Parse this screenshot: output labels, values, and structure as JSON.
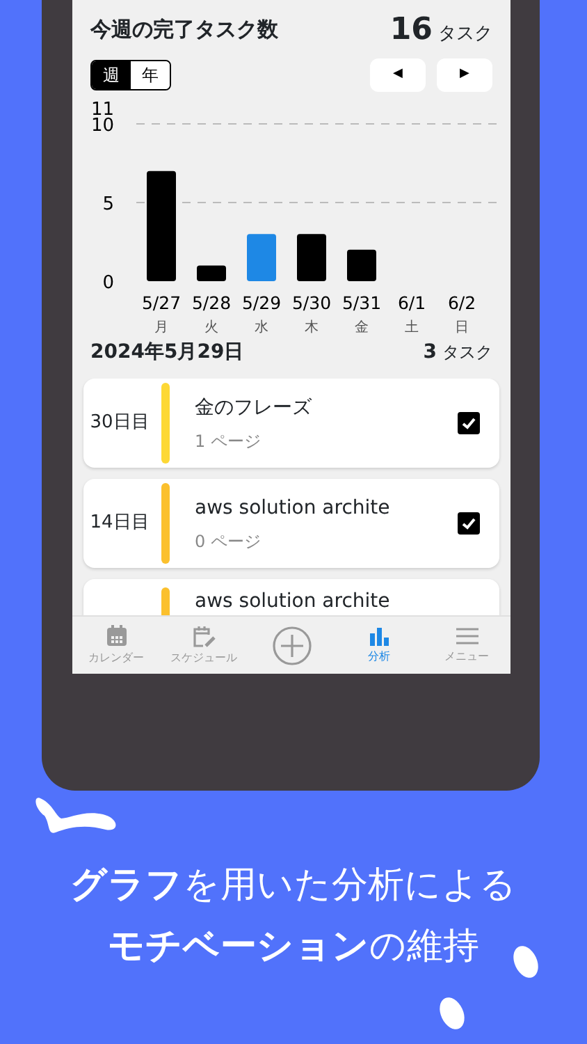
{
  "header": {
    "title": "今週の完了タスク数",
    "count": "16",
    "unit": "タスク"
  },
  "period_toggle": [
    {
      "label": "週",
      "selected": true
    },
    {
      "label": "年",
      "selected": false
    }
  ],
  "nav_buttons": [
    {
      "symbol": "◀"
    },
    {
      "symbol": "▶"
    }
  ],
  "chart": {
    "chart_data": {
      "type": "bar",
      "categories": [
        "5/27",
        "5/28",
        "5/29",
        "5/30",
        "5/31",
        "6/1",
        "6/2"
      ],
      "series": [
        {
          "color": "#000000",
          "values": [
            7,
            1,
            null,
            3,
            2,
            0,
            0
          ]
        },
        {
          "color": "#1e88e5",
          "values": [
            null,
            null,
            3,
            null,
            null,
            null,
            null
          ]
        }
      ],
      "ylim": [
        0,
        11
      ],
      "yticks": [
        0,
        5,
        10,
        11
      ]
    },
    "weekday_labels": [
      "月",
      "火",
      "水",
      "木",
      "金",
      "土",
      "日"
    ]
  },
  "day_heading": {
    "date": "2024年5月29日",
    "count": "3",
    "unit": "タスク"
  },
  "tasks": [
    {
      "day": "30日目",
      "color": "#fdd835",
      "title": "金のフレーズ",
      "pages": "1 ページ",
      "checked": true
    },
    {
      "day": "14日目",
      "color": "#fbc02d",
      "title": "aws solution archite",
      "pages": "0 ページ",
      "checked": true
    },
    {
      "color": "#fbc02d",
      "title": "aws solution archite"
    }
  ],
  "tab_bar": [
    {
      "kind": "calendar",
      "label": "カレンダー",
      "selected": false
    },
    {
      "kind": "schedule",
      "label": "スケジュール",
      "selected": false
    },
    {
      "kind": "add",
      "selected": false
    },
    {
      "kind": "analysis",
      "label": "分析",
      "selected": true
    },
    {
      "kind": "menu",
      "label": "メニュー",
      "selected": false
    }
  ],
  "caption": [
    "**グラフ**を用いた分析による",
    "**モチベーション**の維持"
  ]
}
